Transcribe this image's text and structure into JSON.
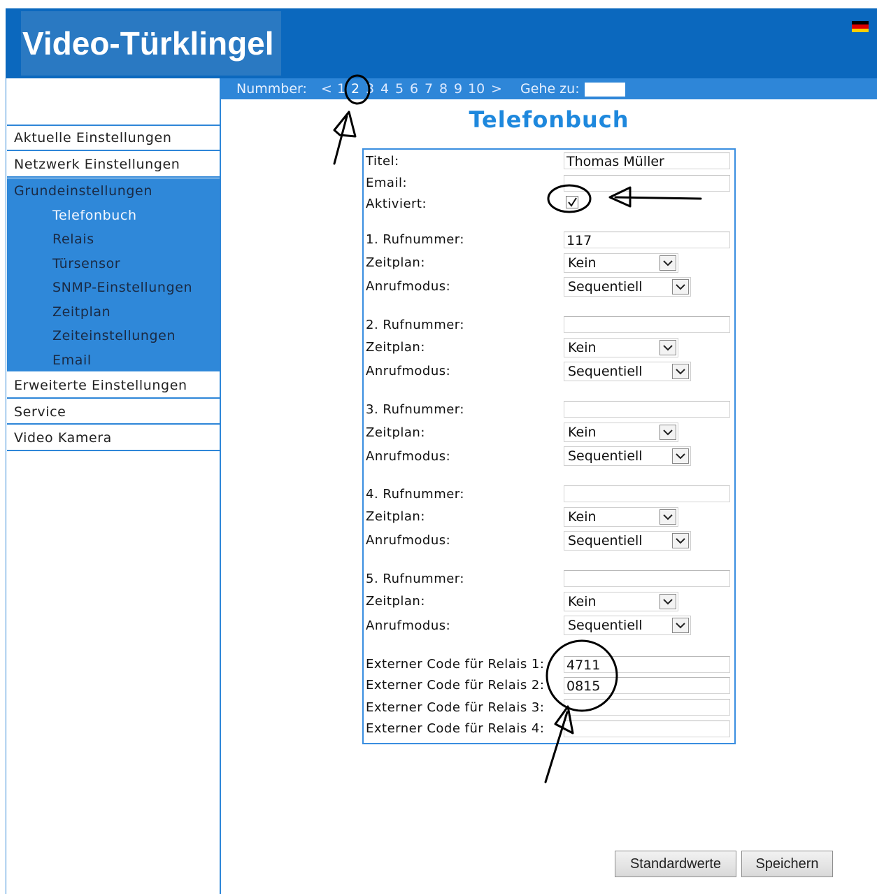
{
  "header": {
    "title": "Video-Türklingel",
    "flag_colors": [
      "#000000",
      "#dd0000",
      "#ffce00"
    ]
  },
  "numbar": {
    "label": "Nummber:",
    "prev": "<",
    "pages": [
      "1",
      "2",
      "3",
      "4",
      "5",
      "6",
      "7",
      "8",
      "9",
      "10"
    ],
    "current_page": "2",
    "next": ">",
    "goto_label": "Gehe zu:",
    "goto_value": ""
  },
  "sidebar": {
    "items": [
      {
        "label": "Aktuelle Einstellungen"
      },
      {
        "label": "Netzwerk Einstellungen"
      },
      {
        "label": "Grundeinstellungen",
        "active": true,
        "children": [
          "Telefonbuch",
          "Relais",
          "Türsensor",
          "SNMP-Einstellungen",
          "Zeitplan",
          "Zeiteinstellungen",
          "Email"
        ],
        "selected_child": "Telefonbuch"
      },
      {
        "label": "Erweiterte Einstellungen"
      },
      {
        "label": "Service"
      },
      {
        "label": "Video Kamera"
      }
    ]
  },
  "page": {
    "heading": "Telefonbuch"
  },
  "form": {
    "titel_label": "Titel:",
    "titel_value": "Thomas Müller",
    "email_label": "Email:",
    "email_value": "",
    "aktiviert_label": "Aktiviert:",
    "aktiviert_checked": true,
    "numbers": [
      {
        "label": "1. Rufnummer:",
        "value": "117",
        "zeitplan_label": "Zeitplan:",
        "zeitplan": "Kein",
        "anrufmodus_label": "Anrufmodus:",
        "anrufmodus": "Sequentiell"
      },
      {
        "label": "2. Rufnummer:",
        "value": "",
        "zeitplan_label": "Zeitplan:",
        "zeitplan": "Kein",
        "anrufmodus_label": "Anrufmodus:",
        "anrufmodus": "Sequentiell"
      },
      {
        "label": "3. Rufnummer:",
        "value": "",
        "zeitplan_label": "Zeitplan:",
        "zeitplan": "Kein",
        "anrufmodus_label": "Anrufmodus:",
        "anrufmodus": "Sequentiell"
      },
      {
        "label": "4. Rufnummer:",
        "value": "",
        "zeitplan_label": "Zeitplan:",
        "zeitplan": "Kein",
        "anrufmodus_label": "Anrufmodus:",
        "anrufmodus": "Sequentiell"
      },
      {
        "label": "5. Rufnummer:",
        "value": "",
        "zeitplan_label": "Zeitplan:",
        "zeitplan": "Kein",
        "anrufmodus_label": "Anrufmodus:",
        "anrufmodus": "Sequentiell"
      }
    ],
    "relais_codes": [
      {
        "label": "Externer Code für Relais 1:",
        "value": "4711"
      },
      {
        "label": "Externer Code für Relais 2:",
        "value": "0815"
      },
      {
        "label": "Externer Code für Relais 3:",
        "value": ""
      },
      {
        "label": "Externer Code für Relais 4:",
        "value": ""
      }
    ]
  },
  "buttons": {
    "defaults": "Standardwerte",
    "save": "Speichern"
  }
}
